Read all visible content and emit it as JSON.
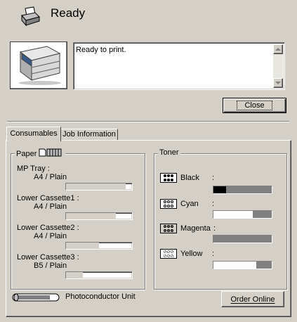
{
  "status": {
    "title": "Ready",
    "message": "Ready to print."
  },
  "buttons": {
    "close": "Close",
    "order_online": "Order Online"
  },
  "tabs": [
    {
      "label": "Consumables",
      "active": true
    },
    {
      "label": "Job Information",
      "active": false
    }
  ],
  "paper": {
    "group_label": "Paper",
    "sources": [
      {
        "name": "MP Tray :",
        "size": "A4 / Plain",
        "level": 0.9
      },
      {
        "name": "Lower Cassette1 :",
        "size": "A4 / Plain",
        "level": 0.75
      },
      {
        "name": "Lower Cassette2 :",
        "size": "A4 / Plain",
        "level": 0.5
      },
      {
        "name": "Lower Cassette3 :",
        "size": "B5 / Plain",
        "level": 0.25
      }
    ]
  },
  "toner": {
    "group_label": "Toner",
    "items": [
      {
        "name": "Black",
        "colon": ":",
        "level": 0.82,
        "bar_color": "#808080",
        "empty_color": "#000000",
        "icon": "black-toner-icon"
      },
      {
        "name": "Cyan",
        "colon": ":",
        "level": 0.2,
        "bar_color": "#808080",
        "empty_color": "#ffffff",
        "icon": "cyan-toner-icon"
      },
      {
        "name": "Magenta",
        "colon": ":",
        "level": 1.0,
        "bar_color": "#808080",
        "empty_color": "#ffffff",
        "icon": "magenta-toner-icon"
      },
      {
        "name": "Yellow",
        "colon": ":",
        "level": 0.25,
        "bar_color": "#808080",
        "empty_color": "#ffffff",
        "icon": "yellow-toner-icon"
      }
    ]
  },
  "photoconductor": {
    "label": "Photoconductor Unit",
    "level": 0.95
  },
  "colors": {
    "window": "#d4d0c8",
    "shadow": "#808080",
    "highlight": "#ffffff"
  }
}
